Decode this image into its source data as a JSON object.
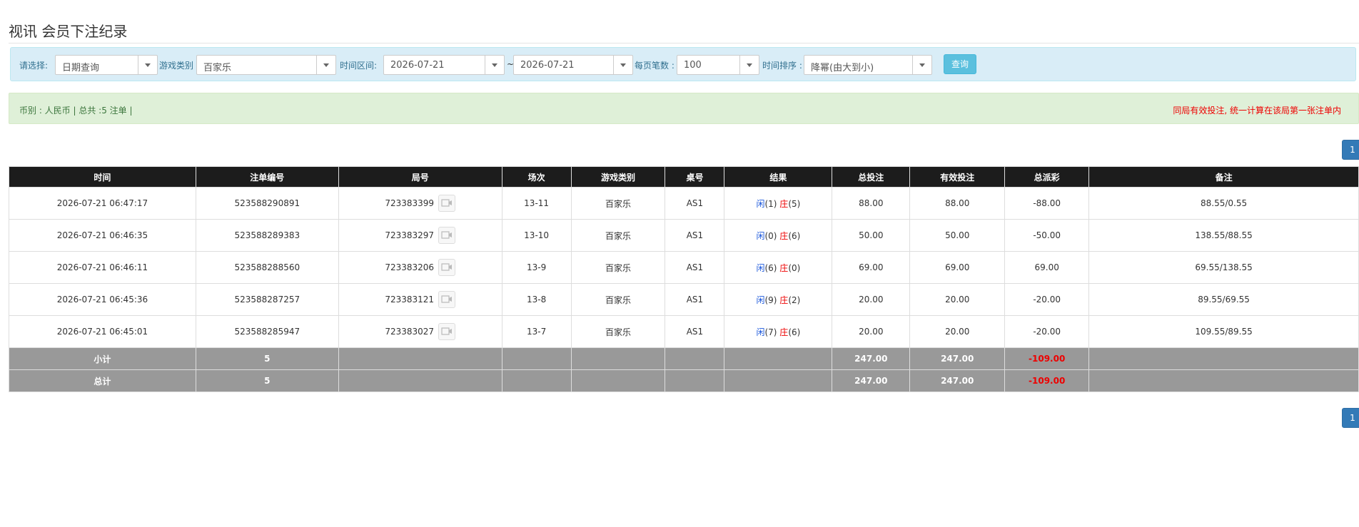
{
  "page": {
    "title": "视讯 会员下注纪录"
  },
  "filters": {
    "choose_label": "请选择:",
    "choose_value": "日期查询",
    "game_label": "游戏类别",
    "game_value": "百家乐",
    "range_label": "时间区间:",
    "start_date": "2026-07-21",
    "range_sep": "~",
    "end_date": "2026-07-21",
    "per_page_label": "每页笔数 :",
    "per_page_value": "100",
    "sort_label": "时间排序 :",
    "sort_value": "降幂(由大到小)",
    "query_label": "查询"
  },
  "summary": {
    "left_text": "币别 : 人民币 | 总共 :5 注单 |",
    "right_text": "同局有效投注, 统一计算在该局第一张注单内"
  },
  "pagination": {
    "current_page": "1"
  },
  "table": {
    "headers": [
      "时间",
      "注单编号",
      "局号",
      "场次",
      "游戏类别",
      "桌号",
      "结果",
      "总投注",
      "有效投注",
      "总派彩",
      "备注"
    ],
    "rows": [
      {
        "time": "2026-07-21 06:47:17",
        "bet_no": "523588290891",
        "round_no": "723383399",
        "shoe": "13-11",
        "game": "百家乐",
        "table": "AS1",
        "result_player_label": "闲",
        "result_player": "(1)",
        "result_banker_label": "庄",
        "result_banker": "(5)",
        "total_bet": "88.00",
        "valid_bet": "88.00",
        "payout": "-88.00",
        "remark": "88.55/0.55"
      },
      {
        "time": "2026-07-21 06:46:35",
        "bet_no": "523588289383",
        "round_no": "723383297",
        "shoe": "13-10",
        "game": "百家乐",
        "table": "AS1",
        "result_player_label": "闲",
        "result_player": "(0)",
        "result_banker_label": "庄",
        "result_banker": "(6)",
        "total_bet": "50.00",
        "valid_bet": "50.00",
        "payout": "-50.00",
        "remark": "138.55/88.55"
      },
      {
        "time": "2026-07-21 06:46:11",
        "bet_no": "523588288560",
        "round_no": "723383206",
        "shoe": "13-9",
        "game": "百家乐",
        "table": "AS1",
        "result_player_label": "闲",
        "result_player": "(6)",
        "result_banker_label": "庄",
        "result_banker": "(0)",
        "total_bet": "69.00",
        "valid_bet": "69.00",
        "payout": "69.00",
        "remark": "69.55/138.55"
      },
      {
        "time": "2026-07-21 06:45:36",
        "bet_no": "523588287257",
        "round_no": "723383121",
        "shoe": "13-8",
        "game": "百家乐",
        "table": "AS1",
        "result_player_label": "闲",
        "result_player": "(9)",
        "result_banker_label": "庄",
        "result_banker": "(2)",
        "total_bet": "20.00",
        "valid_bet": "20.00",
        "payout": "-20.00",
        "remark": "89.55/69.55"
      },
      {
        "time": "2026-07-21 06:45:01",
        "bet_no": "523588285947",
        "round_no": "723383027",
        "shoe": "13-7",
        "game": "百家乐",
        "table": "AS1",
        "result_player_label": "闲",
        "result_player": "(7)",
        "result_banker_label": "庄",
        "result_banker": "(6)",
        "total_bet": "20.00",
        "valid_bet": "20.00",
        "payout": "-20.00",
        "remark": "109.55/89.55"
      }
    ],
    "subtotal": {
      "label": "小计",
      "count": "5",
      "total_bet": "247.00",
      "valid_bet": "247.00",
      "payout": "-109.00"
    },
    "total": {
      "label": "总计",
      "count": "5",
      "total_bet": "247.00",
      "valid_bet": "247.00",
      "payout": "-109.00"
    }
  },
  "colors": {
    "header_bg": "#1c1c1c",
    "filter_bg": "#d9edf7",
    "summary_bg": "#dff0d8",
    "total_row_bg": "#999999",
    "negative": "#ee0000",
    "player_blue": "#1a56db",
    "button_primary": "#337ab7",
    "button_info": "#5bc0de"
  },
  "icons": {
    "round_video": "video-replay-icon",
    "select_arrow": "chevron-down-icon"
  }
}
